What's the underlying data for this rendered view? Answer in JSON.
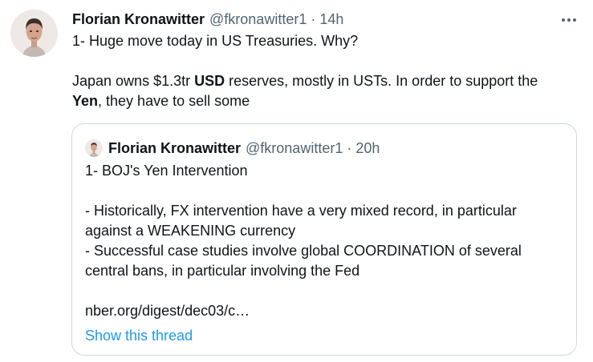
{
  "tweet": {
    "author_name": "Florian Kronawitter",
    "handle": "@fkronawitter1",
    "separator": "·",
    "time": "14h",
    "more_icon": "more-horizontal-icon",
    "line1": "1- Huge move today in US Treasuries. Why?",
    "line2_part1": "Japan owns $1.3tr ",
    "line2_bold": "USD",
    "line2_part2": " reserves, mostly in USTs. In order to support the",
    "line3_bold": "Yen",
    "line3_part2": ", they have to sell some"
  },
  "quote": {
    "author_name": "Florian Kronawitter",
    "handle": "@fkronawitter1",
    "separator": "·",
    "time": "20h",
    "line1": "1- BOJ's Yen Intervention",
    "line2": "- Historically, FX intervention have a very mixed record, in particular",
    "line3": "against a WEAKENING currency",
    "line4": "- Successful case studies involve global COORDINATION of several",
    "line5": "central bans, in particular involving the Fed",
    "link": "nber.org/digest/dec03/c…",
    "show_thread": "Show this thread"
  },
  "colors": {
    "text": "#0f1419",
    "secondary": "#536471",
    "accent": "#1d9bf0",
    "border": "#cfd9de"
  }
}
